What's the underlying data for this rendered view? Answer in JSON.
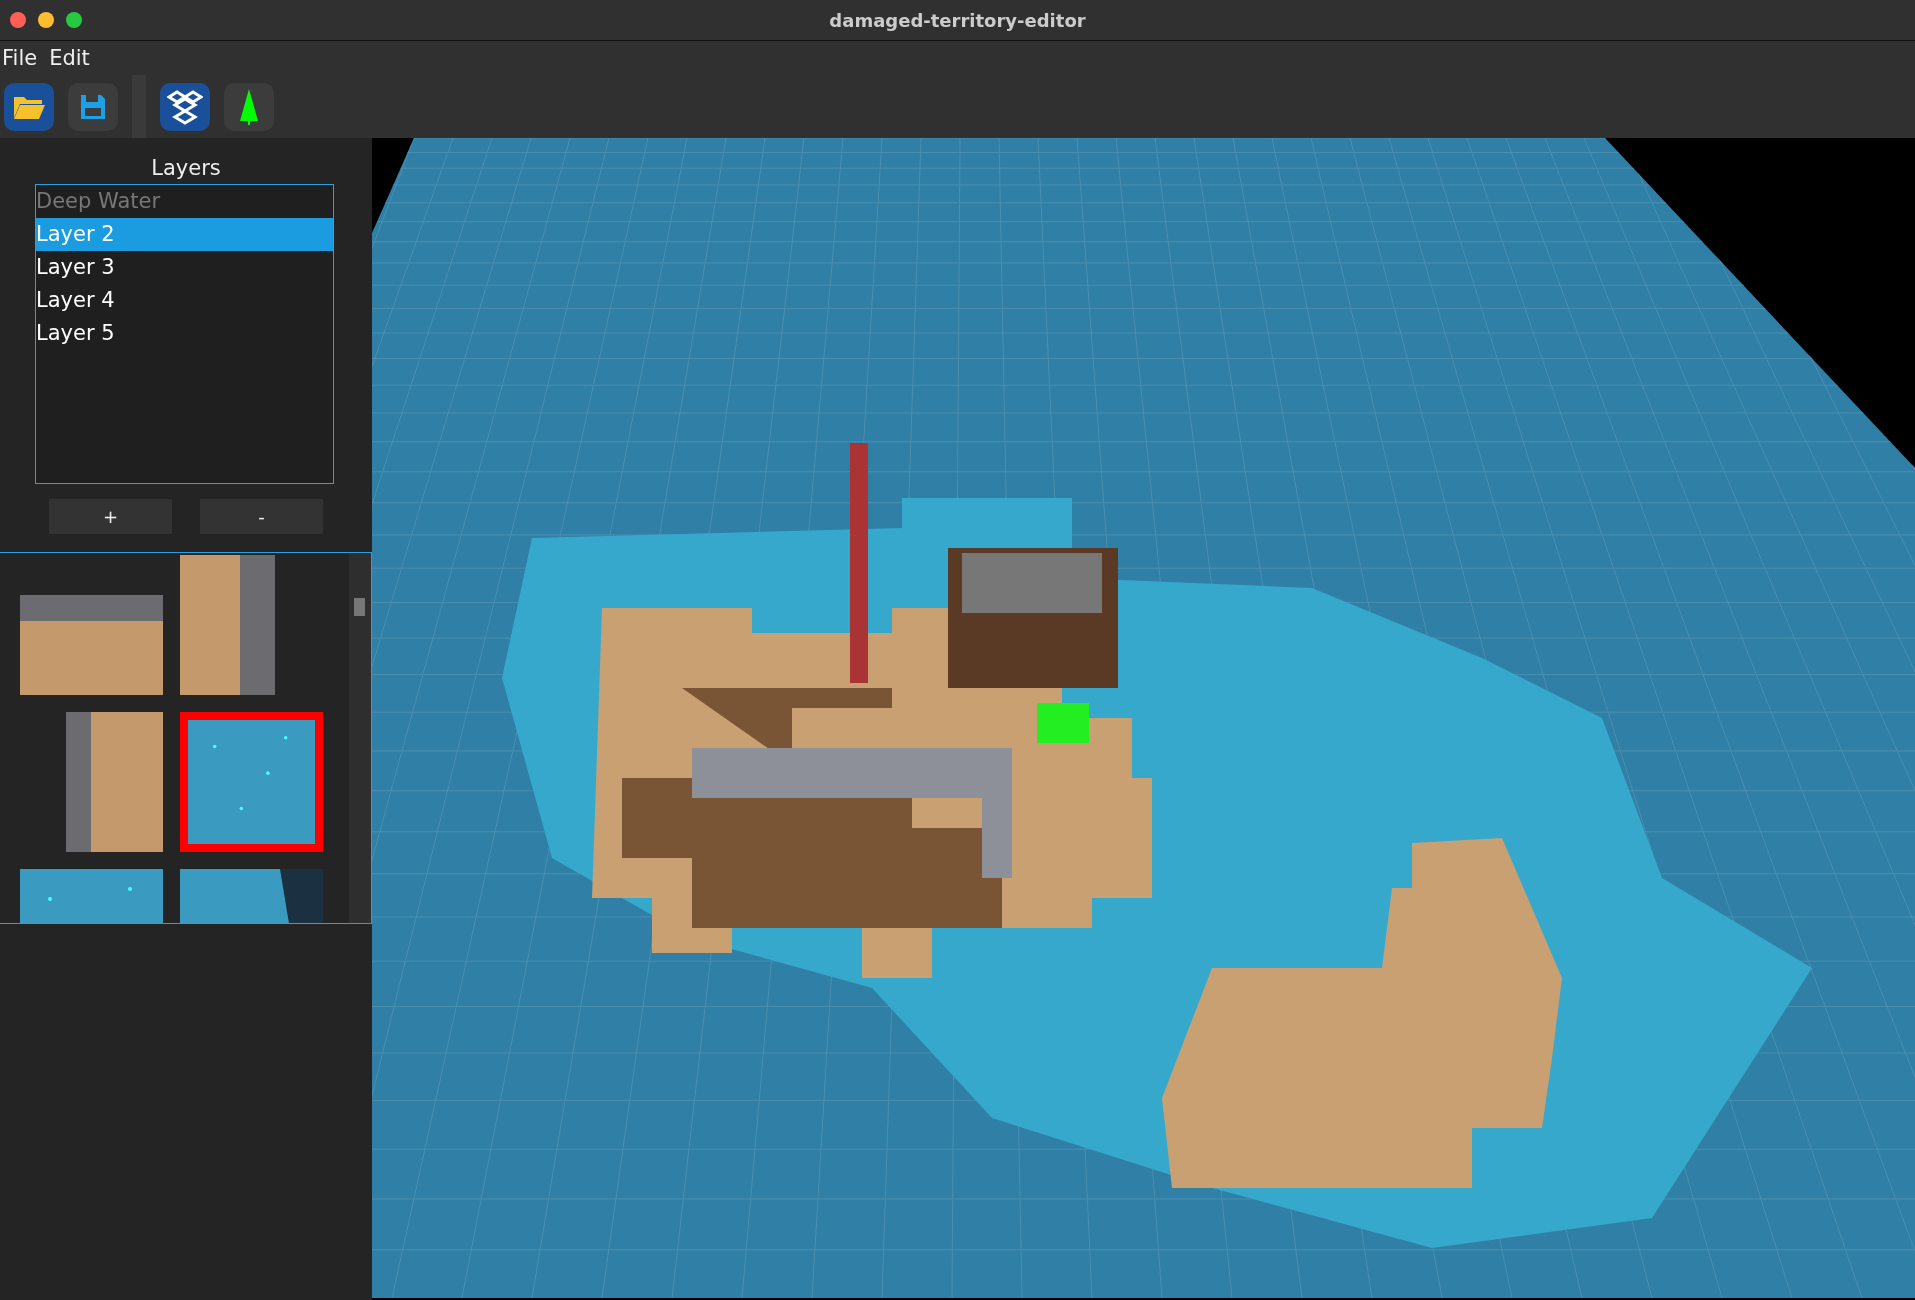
{
  "window": {
    "title": "damaged-territory-editor"
  },
  "menu": [
    "File",
    "Edit"
  ],
  "toolbar": [
    {
      "kind": "open",
      "active": true
    },
    {
      "kind": "save",
      "active": false
    },
    {
      "kind": "layers",
      "active": true
    },
    {
      "kind": "tree",
      "active": false
    }
  ],
  "layers_panel": {
    "title": "Layers",
    "layers": [
      {
        "label": "Deep Water",
        "visible": false,
        "selected": false
      },
      {
        "label": "Layer 2",
        "visible": true,
        "selected": true
      },
      {
        "label": "Layer 3",
        "visible": true,
        "selected": false
      },
      {
        "label": "Layer 4",
        "visible": true,
        "selected": false
      },
      {
        "label": "Layer 5",
        "visible": true,
        "selected": false
      }
    ],
    "buttons": [
      "+",
      "-"
    ]
  },
  "tiles": [
    {
      "kind": "sand-top",
      "selected": false
    },
    {
      "kind": "sand-right",
      "selected": false
    },
    {
      "kind": "sand-left",
      "selected": false
    },
    {
      "kind": "water",
      "selected": true
    },
    {
      "kind": "water",
      "selected": false
    },
    {
      "kind": "water-edge",
      "selected": false
    }
  ]
}
